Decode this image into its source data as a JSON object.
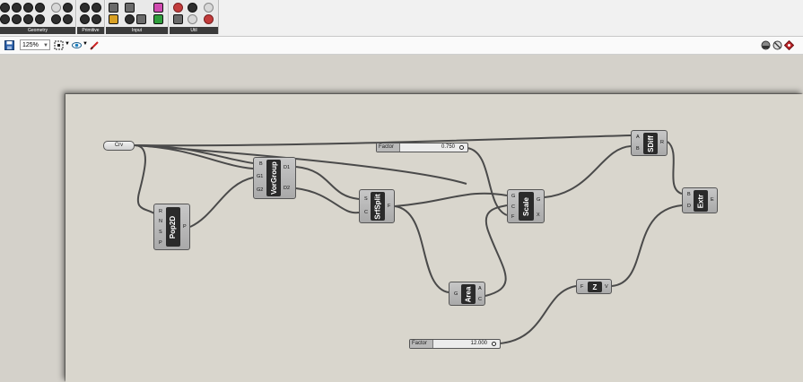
{
  "ribbon": {
    "groups": [
      "Geometry",
      "Primitive",
      "Input",
      "Util"
    ]
  },
  "toolbar": {
    "zoom": "125%"
  },
  "canvas": {
    "components": {
      "crv": {
        "label": "Crv"
      },
      "pop2d": {
        "name": "Pop2D",
        "inputs": [
          "R",
          "N",
          "S",
          "P"
        ],
        "outputs": [
          "P"
        ]
      },
      "vorgroup": {
        "name": "VorGroup",
        "inputs": [
          "B",
          "G1",
          "G2"
        ],
        "outputs": [
          "D1",
          "D2"
        ]
      },
      "srfsplit": {
        "name": "SrfSplit",
        "inputs": [
          "S",
          "C"
        ],
        "outputs": [
          "F"
        ]
      },
      "area": {
        "name": "Area",
        "inputs": [
          "G"
        ],
        "outputs": [
          "A",
          "C"
        ]
      },
      "scale": {
        "name": "Scale",
        "inputs": [
          "G",
          "C",
          "F"
        ],
        "outputs": [
          "G",
          "X"
        ]
      },
      "sdiff": {
        "name": "SDiff",
        "inputs": [
          "A",
          "B"
        ],
        "outputs": [
          "R"
        ]
      },
      "extr": {
        "name": "Extr",
        "inputs": [
          "B",
          "D"
        ],
        "outputs": [
          "E"
        ]
      },
      "z": {
        "name": "Z",
        "inputs": [
          "F"
        ],
        "outputs": [
          "V"
        ]
      }
    },
    "sliders": {
      "factor1": {
        "name": "Factor",
        "value": "0.750"
      },
      "factor2": {
        "name": "Factor",
        "value": "12.000"
      }
    }
  }
}
